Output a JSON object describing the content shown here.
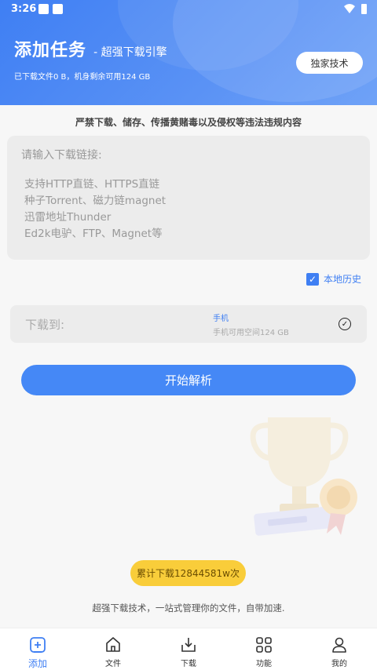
{
  "status_bar": {
    "time": "3:26"
  },
  "header": {
    "title": "添加任务",
    "subtitle": "- 超强下载引擎",
    "storage_info": "已下载文件0 B，机身剩余可用124 GB",
    "exclusive_button": "独家技术"
  },
  "notice": "严禁下载、储存、传播黄赌毒以及侵权等违法违规内容",
  "link_input": {
    "placeholder_title": "请输入下载链接:",
    "placeholder_lines": [
      "支持HTTP直链、HTTPS直链",
      "种子Torrent、磁力链magnet",
      "迅雷地址Thunder",
      "Ed2k电驴、FTP、Magnet等"
    ]
  },
  "local_history": {
    "label": "本地历史",
    "checked": true
  },
  "destination": {
    "label": "下载到:",
    "device": "手机",
    "space": "手机可用空间124 GB"
  },
  "parse_button": "开始解析",
  "counter_badge": "累计下载12844581w次",
  "slogan": "超强下载技术，一站式管理你的文件，自带加速.",
  "nav": {
    "items": [
      {
        "label": "添加",
        "icon": "add-icon",
        "active": true
      },
      {
        "label": "文件",
        "icon": "home-file-icon",
        "active": false
      },
      {
        "label": "下载",
        "icon": "download-icon",
        "active": false
      },
      {
        "label": "功能",
        "icon": "grid-icon",
        "active": false
      },
      {
        "label": "我的",
        "icon": "user-icon",
        "active": false
      }
    ]
  },
  "colors": {
    "primary": "#3f7ff3",
    "badge": "#f9cd3a"
  }
}
